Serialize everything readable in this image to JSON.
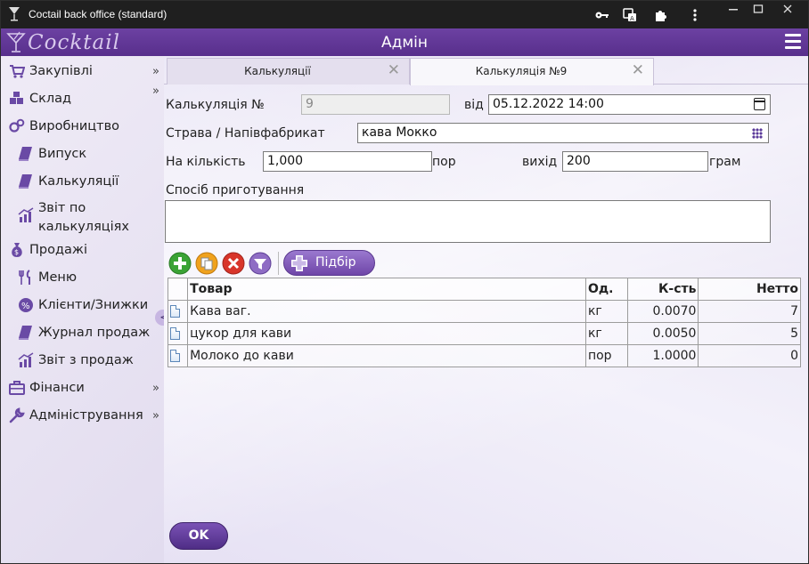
{
  "window": {
    "title": "Coctail back office (standard)",
    "icons": [
      "key-icon",
      "translate-icon",
      "extension-icon",
      "more-vert-icon"
    ],
    "controls": {
      "minimize": "—",
      "maximize": "☐",
      "close": "✕"
    }
  },
  "header": {
    "logo_text": "Cocktail",
    "title": "Адмін"
  },
  "sidebar": {
    "items": [
      {
        "label": "Закупівлі",
        "icon": "cart-icon",
        "arrow": "»"
      },
      {
        "label": "Склад",
        "icon": "boxes-icon",
        "arrow": "»"
      },
      {
        "label": "Виробництво",
        "icon": "cogs-icon"
      },
      {
        "label": "Випуск",
        "icon": "book-icon"
      },
      {
        "label": "Калькуляції",
        "icon": "book-icon"
      },
      {
        "label": "Звіт по",
        "label2": "калькуляціях",
        "icon": "chart-icon"
      },
      {
        "label": "Продажі",
        "icon": "money-bag-icon"
      },
      {
        "label": "Меню",
        "icon": "cutlery-icon"
      },
      {
        "label": "Клієнти/Знижки",
        "icon": "discount-icon"
      },
      {
        "label": "Журнал продаж",
        "icon": "book-icon"
      },
      {
        "label": "Звіт з продаж",
        "icon": "chart-icon"
      },
      {
        "label": "Фінанси",
        "icon": "briefcase-icon",
        "arrow": "»"
      },
      {
        "label": "Адміністрування",
        "icon": "wrench-icon",
        "arrow": "»"
      }
    ],
    "collapse": "<"
  },
  "tabs": [
    {
      "label": "Калькуляції",
      "close": "✕"
    },
    {
      "label": "Калькуляція №9",
      "close": "✕"
    }
  ],
  "form": {
    "calc_no_label": "Калькуляція №",
    "calc_no_value": "9",
    "from_label": "від",
    "date_value": "05.12.2022 14:00",
    "dish_label": "Страва / Напівфабрикат",
    "dish_value": "кава Мокко",
    "qty_label": "На кількість",
    "qty_value": "1,000",
    "qty_unit": "пор",
    "yield_label": "вихід",
    "yield_value": "200",
    "yield_unit": "грам",
    "method_label": "Спосіб приготування",
    "method_value": ""
  },
  "toolbar": {
    "pick_label": "Підбір",
    "tools": [
      "add-icon",
      "copy-icon",
      "delete-icon",
      "filter-icon"
    ]
  },
  "table": {
    "headers": [
      "Товар",
      "Од.",
      "К-сть",
      "Нетто"
    ],
    "rows": [
      {
        "product": "Кава ваг.",
        "unit": "кг",
        "qty": "0.0070",
        "net": "7"
      },
      {
        "product": "цукор для кави",
        "unit": "кг",
        "qty": "0.0050",
        "net": "5"
      },
      {
        "product": "Молоко до кави",
        "unit": "пор",
        "qty": "1.0000",
        "net": "0"
      }
    ]
  },
  "ok_label": "OK"
}
